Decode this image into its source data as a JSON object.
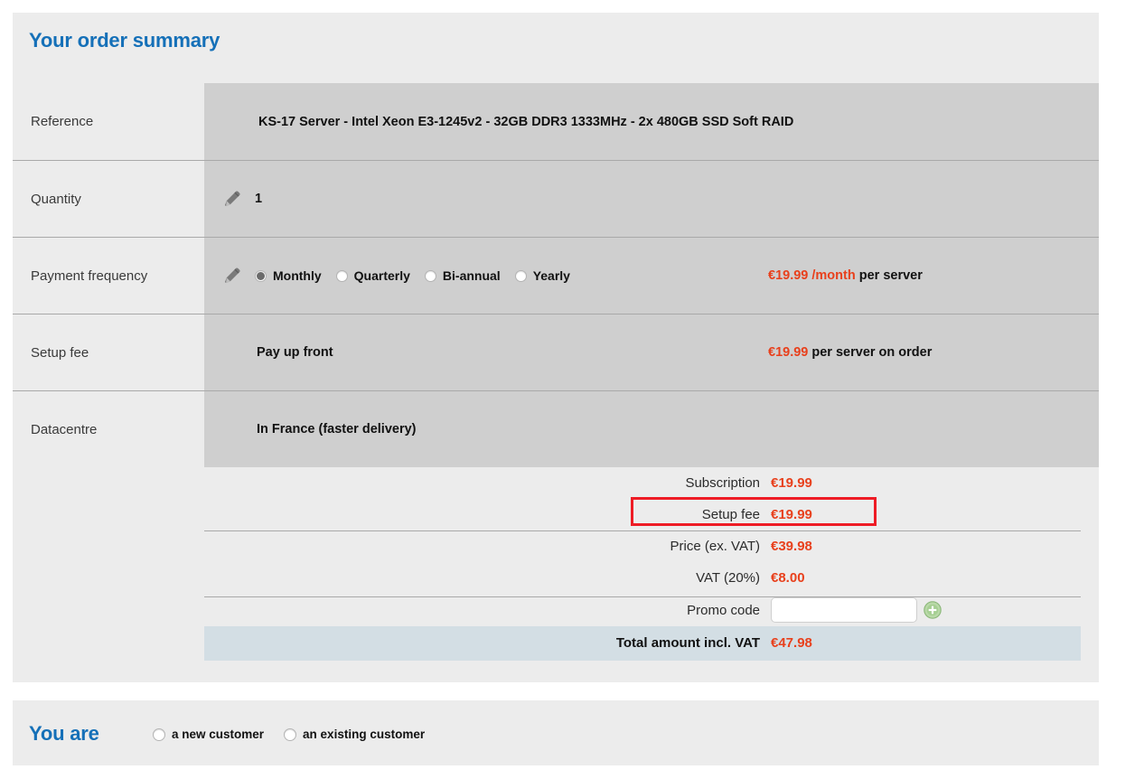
{
  "order_summary": {
    "title": "Your order summary",
    "rows": [
      {
        "label": "Reference",
        "value": "KS-17 Server - Intel Xeon E3-1245v2 - 32GB DDR3 1333MHz - 2x 480GB SSD Soft RAID"
      },
      {
        "label": "Quantity",
        "value": "1",
        "edit_icon": "pencil-icon"
      },
      {
        "label": "Payment frequency",
        "edit_icon": "pencil-icon"
      },
      {
        "label": "Setup fee",
        "value": "Pay up front"
      },
      {
        "label": "Datacentre",
        "value": "In France (faster delivery)"
      }
    ],
    "payment_frequency": {
      "options": [
        {
          "label": "Monthly",
          "selected": true
        },
        {
          "label": "Quarterly",
          "selected": false
        },
        {
          "label": "Bi-annual",
          "selected": false
        },
        {
          "label": "Yearly",
          "selected": false
        }
      ],
      "price": "€19.99 /month",
      "price_suffix": "per server"
    },
    "setup_fee": {
      "price": "€19.99",
      "price_suffix": "per server on order"
    },
    "totals": [
      {
        "label": "Subscription",
        "value": "€19.99"
      },
      {
        "label": "Setup fee",
        "value": "€19.99",
        "highlighted": true
      },
      {
        "label": "Price (ex. VAT)",
        "value": "€39.98"
      },
      {
        "label": "VAT (20%)",
        "value": "€8.00"
      }
    ],
    "promo": {
      "label": "Promo code",
      "value": "",
      "placeholder": "",
      "add_button": "add-promo-icon"
    },
    "total_amount": {
      "label": "Total amount incl. VAT",
      "value": "€47.98"
    }
  },
  "customer": {
    "title": "You are",
    "options": [
      {
        "label": "a new customer",
        "selected": false
      },
      {
        "label": "an existing customer",
        "selected": false
      }
    ]
  },
  "colors": {
    "brand_blue": "#1570b8",
    "price_red": "#e8401c",
    "highlight_red": "#ee1c25",
    "panel_bg": "#ececec",
    "value_bg": "#cfcfcf",
    "total_bg": "#d3dee4",
    "add_green": "#8cc27c"
  }
}
